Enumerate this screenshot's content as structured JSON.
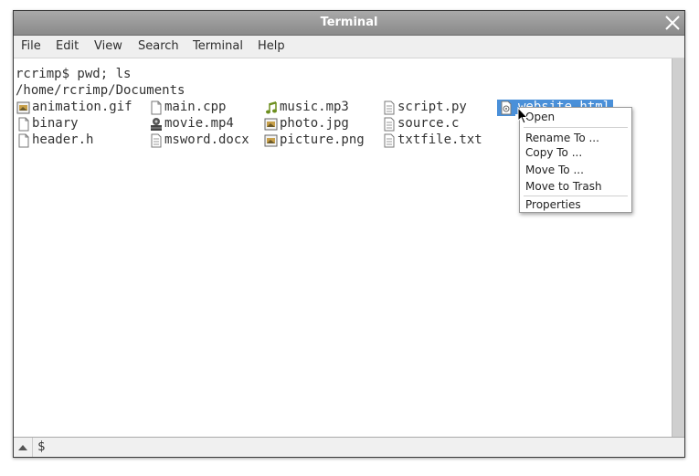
{
  "window": {
    "title": "Terminal"
  },
  "menu": [
    "File",
    "Edit",
    "View",
    "Search",
    "Terminal",
    "Help"
  ],
  "terminal": {
    "command_line": "rcrimp$ pwd; ls",
    "cwd_line": "/home/rcrimp/Documents"
  },
  "files": [
    {
      "name": "animation.gif",
      "icon": "image-file-icon"
    },
    {
      "name": "binary",
      "icon": "document-file-icon"
    },
    {
      "name": "header.h",
      "icon": "document-file-icon"
    },
    {
      "name": "main.cpp",
      "icon": "document-file-icon"
    },
    {
      "name": "movie.mp4",
      "icon": "video-file-icon"
    },
    {
      "name": "msword.docx",
      "icon": "text-file-icon"
    },
    {
      "name": "music.mp3",
      "icon": "music-file-icon"
    },
    {
      "name": "photo.jpg",
      "icon": "image-file-icon"
    },
    {
      "name": "picture.png",
      "icon": "image-file-icon"
    },
    {
      "name": "script.py",
      "icon": "text-file-icon"
    },
    {
      "name": "source.c",
      "icon": "text-file-icon"
    },
    {
      "name": "txtfile.txt",
      "icon": "text-file-icon"
    },
    {
      "name": "website.html",
      "icon": "html-file-icon",
      "selected": true
    }
  ],
  "context_menu": [
    "Open",
    "Rename To ...",
    "Copy To ...",
    "Move To ...",
    "Move to Trash",
    "Properties"
  ],
  "prompt": "$",
  "colors": {
    "selection": "#4a90d9",
    "titlebar": "#999999"
  }
}
